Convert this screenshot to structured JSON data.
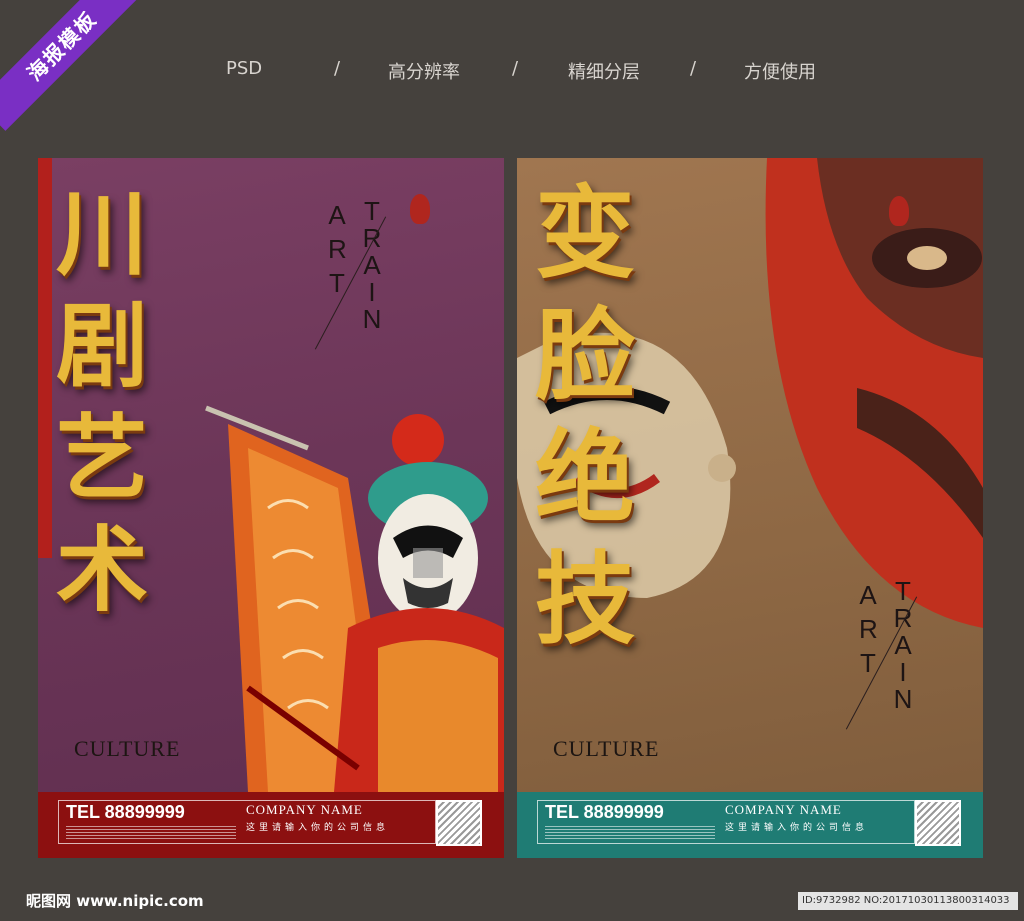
{
  "corner_badge": "海报模板",
  "features": [
    "PSD",
    "/",
    "高分辨率",
    "/",
    "精细分层",
    "/",
    "方便使用"
  ],
  "posters": [
    {
      "title_chars": [
        "川",
        "剧",
        "艺",
        "术"
      ],
      "art": "ART",
      "train": "TRAIN",
      "culture": "CULTURE",
      "tel": "TEL 88899999",
      "company": "COMPANY NAME",
      "company_info": "这里请输入你的公司信息",
      "footer_color": "#8c1010"
    },
    {
      "title_chars": [
        "变",
        "脸",
        "绝",
        "技"
      ],
      "art": "ART",
      "train": "TRAIN",
      "culture": "CULTURE",
      "tel": "TEL 88899999",
      "company": "COMPANY NAME",
      "company_info": "这里请输入你的公司信息",
      "footer_color": "#1f7c74"
    }
  ],
  "watermark": "昵图网 www.nipic.com",
  "image_id": "ID:9732982 NO:20171030113800314033",
  "colors": {
    "background": "#45413d",
    "poster1_bg": "#6c3658",
    "poster2_bg": "#8e6844",
    "gold_text": "#e8b93a",
    "badge": "#7a2fc4"
  },
  "icons": [
    "opera-figure-image",
    "opera-mask-image",
    "red-seal-icon",
    "qr-code-icon"
  ]
}
